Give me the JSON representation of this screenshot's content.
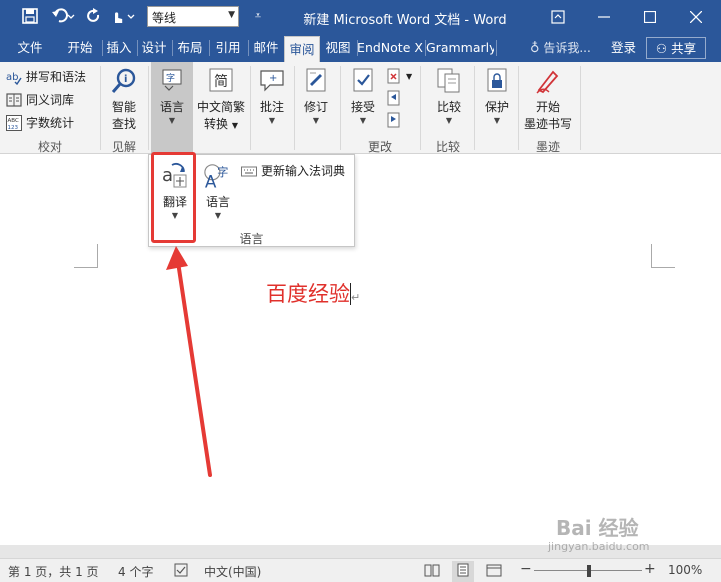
{
  "titlebar": {
    "font_name": "等线",
    "title": "新建 Microsoft Word 文档 - Word"
  },
  "tabs": [
    {
      "label": "文件"
    },
    {
      "label": "开始"
    },
    {
      "label": "插入"
    },
    {
      "label": "设计"
    },
    {
      "label": "布局"
    },
    {
      "label": "引用"
    },
    {
      "label": "邮件"
    },
    {
      "label": "审阅",
      "active": true
    },
    {
      "label": "视图"
    },
    {
      "label": "EndNote X"
    },
    {
      "label": "Grammarly"
    }
  ],
  "tellme": "告诉我...",
  "signin": "登录",
  "share": "共享",
  "ribbon": {
    "proofing": {
      "spelling": "拼写和语法",
      "thesaurus": "同义词库",
      "wordcount": "字数统计",
      "label": "校对"
    },
    "insights": {
      "smart_lookup_1": "智能",
      "smart_lookup_2": "查找",
      "label": "见解"
    },
    "language": {
      "label": "语言"
    },
    "chinese_conv": {
      "line1": "中文简繁",
      "line2": "转换"
    },
    "comments": {
      "label": "批注"
    },
    "tracking": {
      "label": "修订"
    },
    "changes": {
      "accept": "接受",
      "label": "更改"
    },
    "compare": {
      "compare": "比较",
      "label": "比较"
    },
    "protect": {
      "protect": "保护"
    },
    "ink": {
      "line1": "开始",
      "line2": "墨迹书写",
      "label": "墨迹"
    }
  },
  "dropdown": {
    "translate": "翻译",
    "language": "语言",
    "update_ime": "更新输入法词典",
    "footer": "语言"
  },
  "document": {
    "text": "百度经验"
  },
  "statusbar": {
    "page": "第 1 页，共 1 页",
    "words": "4 个字",
    "lang": "中文(中国)",
    "zoom": "100%"
  },
  "watermark": {
    "main": "Bai 经验",
    "sub": "jingyan.baidu.com"
  },
  "colors": {
    "title_blue": "#2b579a",
    "red": "#e53a35",
    "doc_text": "#e0302b"
  }
}
